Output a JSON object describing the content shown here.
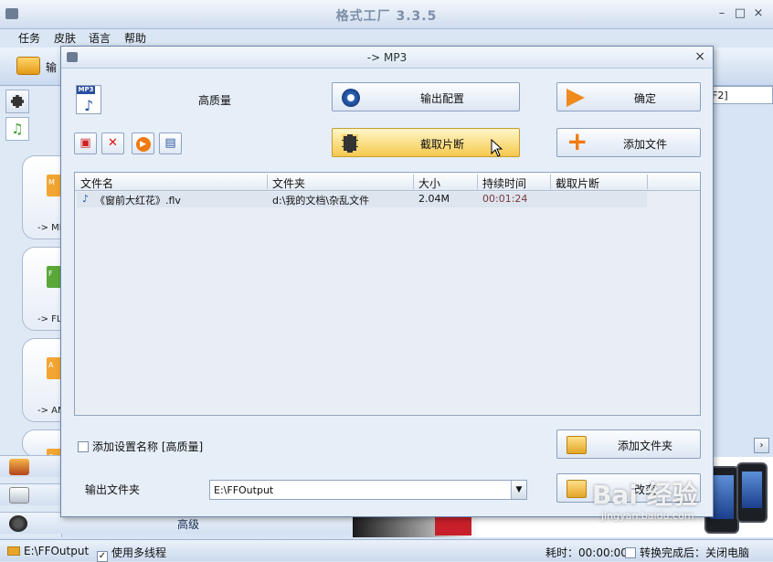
{
  "app": {
    "title": "格式工厂 3.3.5",
    "window_buttons": {
      "minimize": "–",
      "maximize": "□",
      "close": "×"
    },
    "menu": [
      "任务",
      "皮肤",
      "语言",
      "帮助"
    ],
    "toolbar_partial_label": "输",
    "right_field_text": "F2]",
    "left_cards": [
      "-> MP",
      "-> FL",
      "-> AM"
    ],
    "card_badges": [
      "M",
      "F",
      "A",
      "O"
    ],
    "advanced_label": "高级",
    "scroll_right": "›"
  },
  "dialog": {
    "title": "-> MP3",
    "close": "×",
    "format_tag": "MP3",
    "quality": "高质量",
    "buttons": {
      "output_config": "输出配置",
      "ok": "确定",
      "clip": "截取片断",
      "add_file": "添加文件",
      "add_folder": "添加文件夹",
      "change": "改变"
    },
    "table": {
      "columns": [
        "文件名",
        "文件夹",
        "大小",
        "持续时间",
        "截取片断"
      ],
      "rows": [
        {
          "name": "《窗前大红花》.flv",
          "folder": "d:\\我的文档\\杂乱文件",
          "size": "2.04M",
          "duration": "00:01:24",
          "clip": ""
        }
      ]
    },
    "add_settings_name": {
      "label": "添加设置名称 [高质量]",
      "checked": false
    },
    "output_folder": {
      "label": "输出文件夹",
      "value": "E:\\FFOutput"
    }
  },
  "statusbar": {
    "path": "E:\\FFOutput",
    "multithread": {
      "label": "使用多线程",
      "checked": true
    },
    "elapsed": "耗时：00:00:00",
    "shutdown": {
      "label": "转换完成后：关闭电脑",
      "checked": false
    }
  },
  "watermark": {
    "main": "Bai 经验",
    "sub": "jingyan.baidu.com"
  },
  "colors": {
    "accent": "#f6c94e",
    "title_text": "#7d8fa8",
    "window_bg": "#e6eef8"
  }
}
